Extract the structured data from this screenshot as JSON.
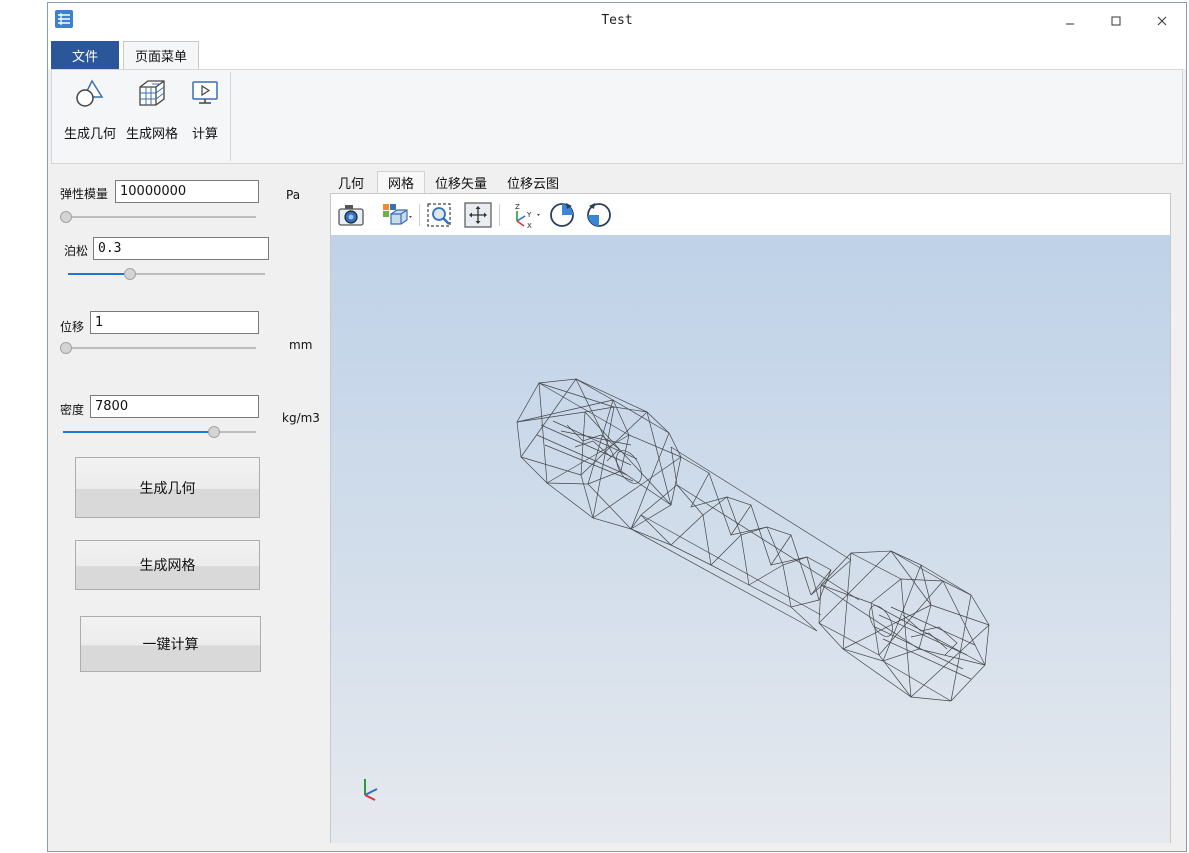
{
  "window": {
    "title": "Test",
    "minimize_icon": "minimize-icon",
    "maximize_icon": "maximize-icon",
    "close_icon": "close-icon"
  },
  "menu_tabs": {
    "file": "文件",
    "page_menu": "页面菜单"
  },
  "ribbon": {
    "buttons": [
      {
        "label": "生成几何",
        "icon": "geometry-icon"
      },
      {
        "label": "生成网格",
        "icon": "mesh-icon"
      },
      {
        "label": "计算",
        "icon": "compute-icon"
      }
    ]
  },
  "params": {
    "elastic_modulus": {
      "label": "弹性模量",
      "value": "10000000",
      "unit": "Pa",
      "slider": 0.0
    },
    "poisson": {
      "label": "泊松",
      "value": "0.3",
      "slider": 0.3
    },
    "displacement": {
      "label": "位移",
      "value": "1",
      "unit": "mm",
      "slider": 0.0
    },
    "density": {
      "label": "密度",
      "value": "7800",
      "unit": "kg/m3",
      "slider": 0.8
    }
  },
  "actions": {
    "gen_geometry": "生成几何",
    "gen_mesh": "生成网格",
    "one_click_compute": "一键计算"
  },
  "view_tabs": [
    "几何",
    "网格",
    "位移矢量",
    "位移云图"
  ],
  "active_view_tab": "网格",
  "viewer_toolbar": [
    "camera-icon",
    "view-orientation-icon",
    "zoom-box-icon",
    "fit-all-icon",
    "axes-orientation-icon",
    "rotate-cw-icon",
    "rotate-ccw-icon"
  ],
  "colors": {
    "accent": "#2b579a",
    "slider_fill": "#1979d2",
    "viewport_top": "#bfd2e8",
    "viewport_bottom": "#e6e9ee"
  }
}
